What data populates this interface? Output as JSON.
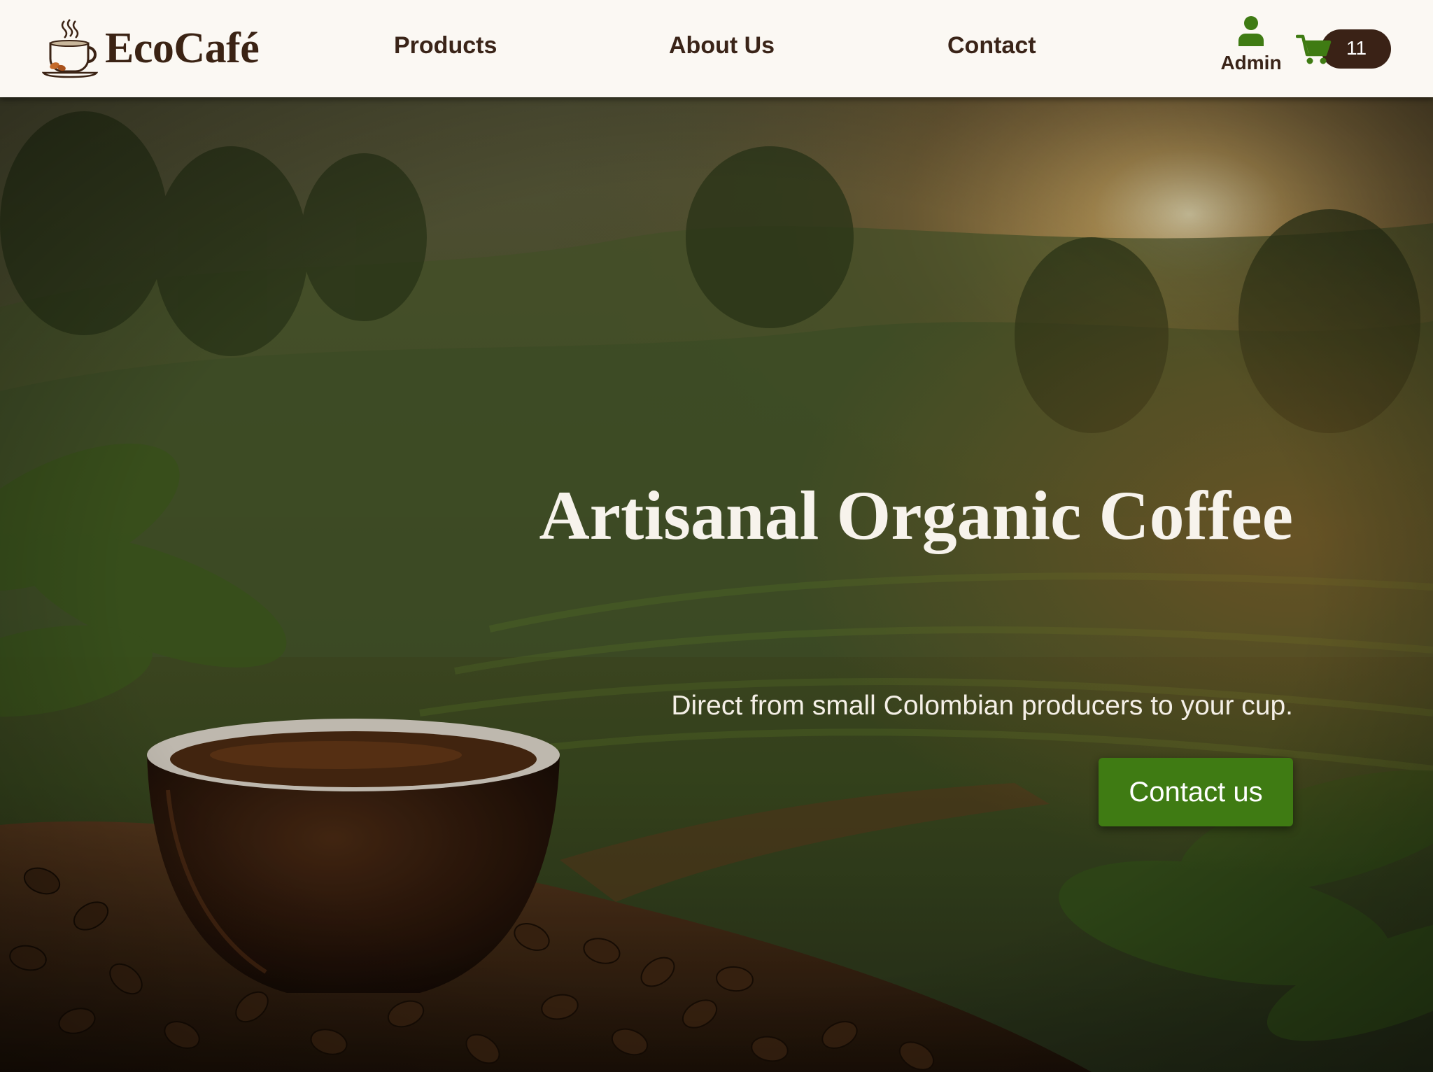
{
  "header": {
    "brand_name": "EcoCafé",
    "nav": {
      "products": "Products",
      "about": "About Us",
      "contact": "Contact"
    },
    "account": {
      "label": "Admin",
      "icon": "user-icon"
    },
    "cart": {
      "count": "11",
      "icon": "cart-icon"
    }
  },
  "hero": {
    "title": "Artisanal Organic Coffee",
    "subtitle": "Direct from small Colombian producers to your cup.",
    "cta_label": "Contact us",
    "background": "coffee-plantation-with-cup-photo"
  },
  "colors": {
    "header_bg": "#fbf8f3",
    "text_dark": "#3a2418",
    "accent_green": "#3f7b13",
    "cart_pill": "#3a2216"
  }
}
